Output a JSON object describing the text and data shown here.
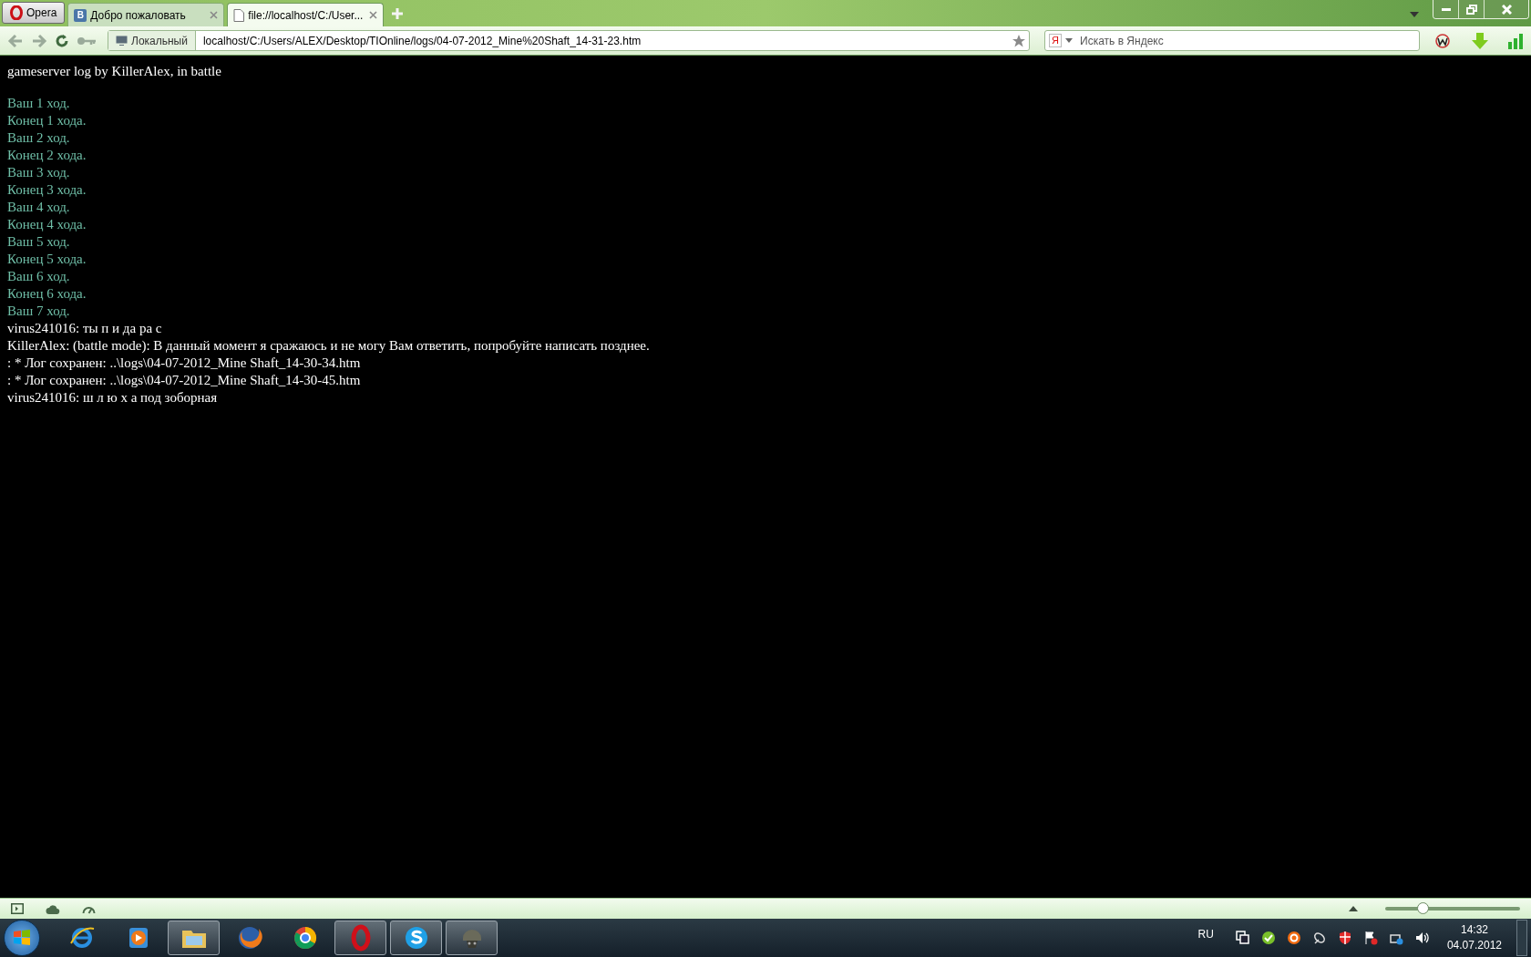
{
  "browser": {
    "menu_button": "Opera",
    "tabs": [
      {
        "title": "Добро пожаловать",
        "favicon": "В",
        "selected": false
      },
      {
        "title": "file://localhost/C:/User...",
        "selected": true
      }
    ],
    "address_bar": {
      "security_badge": "Локальный",
      "url": "localhost/C:/Users/ALEX/Desktop/TIOnline/logs/04-07-2012_Mine%20Shaft_14-31-23.htm"
    },
    "search_field": {
      "engine_badge": "Я",
      "placeholder": "Искать в Яндекс"
    }
  },
  "page": {
    "heading": "gameserver log by KillerAlex, in battle",
    "lines": [
      {
        "kind": "turn",
        "text": "Ваш 1 ход."
      },
      {
        "kind": "turn",
        "text": "Конец 1 хода."
      },
      {
        "kind": "turn",
        "text": "Ваш 2 ход."
      },
      {
        "kind": "turn",
        "text": "Конец 2 хода."
      },
      {
        "kind": "turn",
        "text": "Ваш 3 ход."
      },
      {
        "kind": "turn",
        "text": "Конец 3 хода."
      },
      {
        "kind": "turn",
        "text": "Ваш 4 ход."
      },
      {
        "kind": "turn",
        "text": "Конец 4 хода."
      },
      {
        "kind": "turn",
        "text": "Ваш 5 ход."
      },
      {
        "kind": "turn",
        "text": "Конец 5 хода."
      },
      {
        "kind": "turn",
        "text": "Ваш 6 ход."
      },
      {
        "kind": "turn",
        "text": "Конец 6 хода."
      },
      {
        "kind": "turn",
        "text": "Ваш 7 ход."
      },
      {
        "kind": "message",
        "text": "virus241016: ты п и да ра с"
      },
      {
        "kind": "message",
        "text": "KillerAlex: (battle mode): В данный момент я сражаюсь и не могу Вам ответить, попробуйте написать позднее."
      },
      {
        "kind": "message",
        "text": ": * Лог сохранен: ..\\logs\\04-07-2012_Mine Shaft_14-30-34.htm"
      },
      {
        "kind": "message",
        "text": ": * Лог сохранен: ..\\logs\\04-07-2012_Mine Shaft_14-30-45.htm"
      },
      {
        "kind": "message",
        "text": "virus241016: ш л ю х а под зоборная"
      }
    ]
  },
  "status_bar": {
    "zoom_slider": {
      "level": 0.28
    }
  },
  "taskbar": {
    "pinned": [
      {
        "kind": "ie",
        "active": false
      },
      {
        "kind": "media",
        "active": false
      },
      {
        "kind": "folder",
        "active": true
      },
      {
        "kind": "firefox",
        "active": false
      },
      {
        "kind": "chrome",
        "active": false
      },
      {
        "kind": "opera",
        "active": true
      },
      {
        "kind": "skype",
        "active": true
      },
      {
        "kind": "game",
        "active": true
      }
    ],
    "language": "RU",
    "time": "14:32",
    "date": "04.07.2012"
  }
}
